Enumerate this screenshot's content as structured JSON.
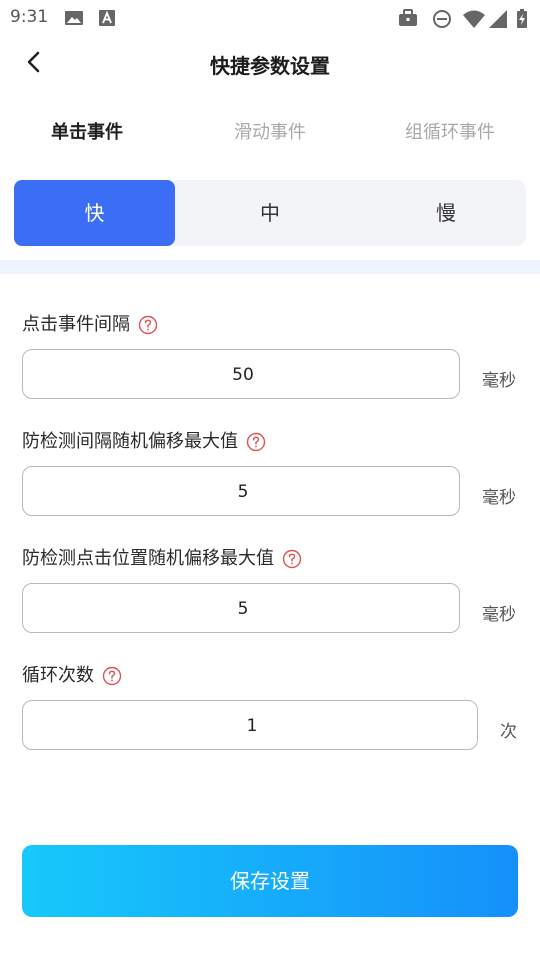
{
  "status_bar": {
    "time": "9:31"
  },
  "header": {
    "title": "快捷参数设置"
  },
  "tabs": [
    {
      "label": "单击事件",
      "active": true
    },
    {
      "label": "滑动事件",
      "active": false
    },
    {
      "label": "组循环事件",
      "active": false
    }
  ],
  "speed": {
    "options": [
      "快",
      "中",
      "慢"
    ],
    "selected": "快"
  },
  "form": {
    "fields": [
      {
        "label": "点击事件间隔",
        "value": "50",
        "unit": "毫秒"
      },
      {
        "label": "防检测间隔随机偏移最大值",
        "value": "5",
        "unit": "毫秒"
      },
      {
        "label": "防检测点击位置随机偏移最大值",
        "value": "5",
        "unit": "毫秒"
      },
      {
        "label": "循环次数",
        "value": "1",
        "unit": "次"
      }
    ]
  },
  "save_button": {
    "label": "保存设置"
  },
  "colors": {
    "accent": "#3b6ef5",
    "help_icon": "#e05252",
    "save_gradient_start": "#17c9fb",
    "save_gradient_end": "#1590f9"
  }
}
